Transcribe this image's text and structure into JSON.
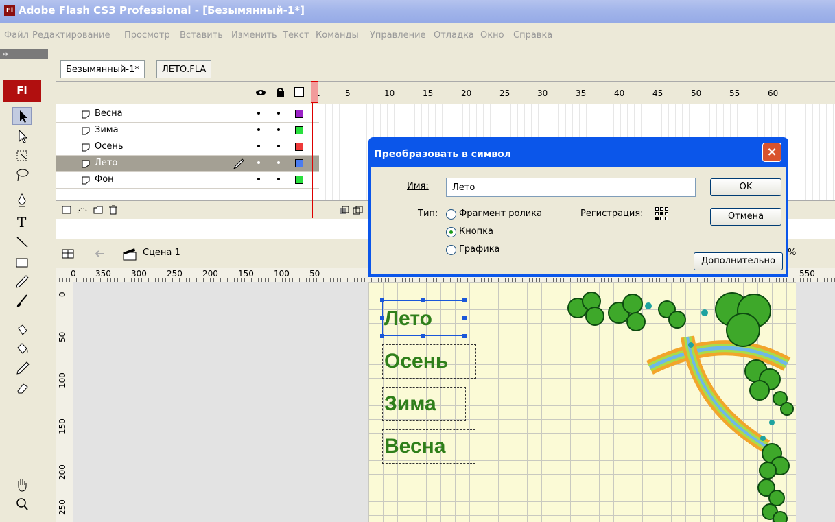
{
  "window": {
    "title": "Adobe Flash CS3 Professional - [Безымянный-1*]",
    "logo": "Fl"
  },
  "menu": [
    "Файл",
    "Редактирование",
    "Просмотр",
    "Вставить",
    "Изменить",
    "Текст",
    "Команды",
    "Управление",
    "Отладка",
    "Окно",
    "Справка"
  ],
  "toolbar": {
    "badge": "Fl",
    "head": "▸▸"
  },
  "tabs": [
    {
      "label": "Безымянный-1*",
      "active": true
    },
    {
      "label": "ЛЕТО.FLA",
      "active": false
    }
  ],
  "timeline": {
    "frame_numbers": [
      "1",
      "5",
      "10",
      "15",
      "20",
      "25",
      "30",
      "35",
      "40",
      "45",
      "50",
      "55",
      "60"
    ],
    "layers": [
      {
        "name": "Весна",
        "color": "#9b22c7",
        "active": false
      },
      {
        "name": "Зима",
        "color": "#29e03e",
        "active": false
      },
      {
        "name": "Осень",
        "color": "#ef3a3a",
        "active": false
      },
      {
        "name": "Лето",
        "color": "#4a7cf0",
        "active": true
      },
      {
        "name": "Фон",
        "color": "#29e03e",
        "active": false
      }
    ]
  },
  "scene": {
    "label": "Сцена 1"
  },
  "ruler": {
    "horizontal": [
      "0",
      "350",
      "300",
      "250",
      "200",
      "150",
      "100",
      "50",
      "550"
    ],
    "vertical": [
      "0",
      "50",
      "100",
      "150",
      "200",
      "250"
    ]
  },
  "stage": {
    "texts": [
      "Лето",
      "Осень",
      "Зима",
      "Весна"
    ],
    "zoom_suffix": "%"
  },
  "dialog": {
    "title": "Преобразовать в символ",
    "name_label": "Имя:",
    "name_value": "Лето",
    "type_label": "Тип:",
    "types": [
      "Фрагмент ролика",
      "Кнопка",
      "Графика"
    ],
    "selected_type": "Кнопка",
    "registration_label": "Регистрация:",
    "ok": "OK",
    "cancel": "Отмена",
    "advanced": "Дополнительно"
  },
  "colors": {
    "title_bar": "#a2b5ea",
    "stage_text": "#2f7f1a",
    "dialog_frame": "#0b56ea"
  }
}
